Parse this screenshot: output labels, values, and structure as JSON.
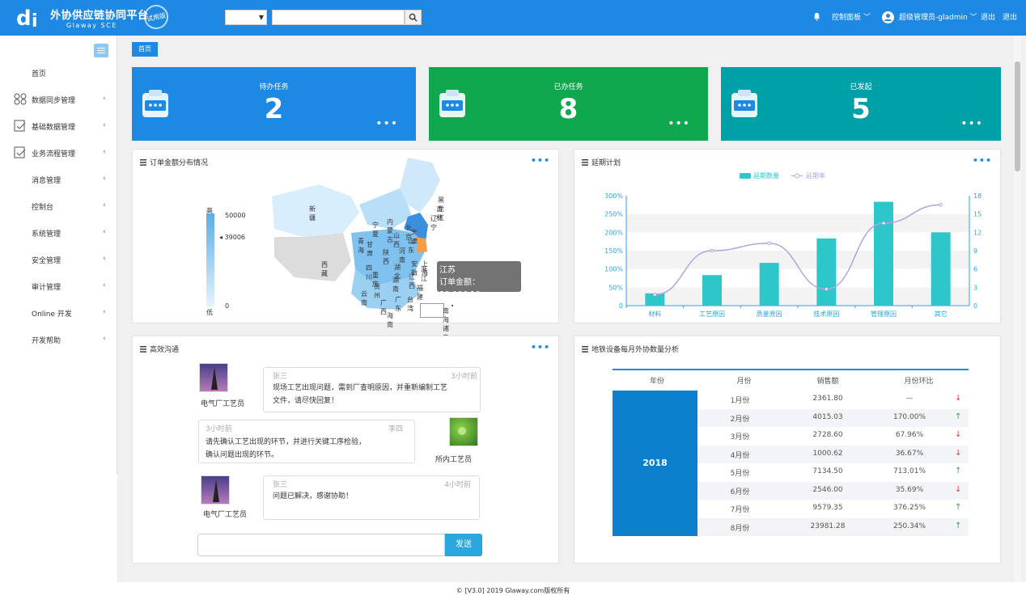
{
  "brand": {
    "title": "外协供应链协同平台",
    "subtitle": "Glaway SCE",
    "stamp": "试用版"
  },
  "topbar": {
    "dashboard": "控制面板 ﹀",
    "user": "超级管理员-gladmin ﹀",
    "logout1": "退出",
    "logout2": "退出"
  },
  "sidebar": {
    "items": [
      {
        "label": "首页",
        "chevron": ""
      },
      {
        "label": "数据同步管理",
        "chevron": "‹"
      },
      {
        "label": "基础数据管理",
        "chevron": "‹"
      },
      {
        "label": "业务流程管理",
        "chevron": "‹"
      },
      {
        "label": "消息管理",
        "chevron": "‹"
      },
      {
        "label": "控制台",
        "chevron": "‹"
      },
      {
        "label": "系统管理",
        "chevron": "‹"
      },
      {
        "label": "安全管理",
        "chevron": "‹"
      },
      {
        "label": "审计管理",
        "chevron": "‹"
      },
      {
        "label": "Online 开发",
        "chevron": "‹"
      },
      {
        "label": "开发帮助",
        "chevron": "‹"
      }
    ]
  },
  "breadcrumb": "首页",
  "stats": [
    {
      "title": "待办任务",
      "value": "2",
      "color": "#1e88e5"
    },
    {
      "title": "已办任务",
      "value": "8",
      "color": "#0fa84f"
    },
    {
      "title": "已发起",
      "value": "5",
      "color": "#00a0a8"
    }
  ],
  "more": "•••",
  "map_panel": {
    "title": "订单金额分布情况",
    "legend_high": "高",
    "legend_low": "低",
    "legend_values": [
      "50000",
      "39006",
      "0"
    ],
    "provinces": [
      "黑龙江",
      "吉林",
      "辽宁",
      "内蒙古",
      "新疆",
      "宁夏",
      "北京",
      "天津",
      "青海",
      "甘肃",
      "山西",
      "山东",
      "陕西",
      "河南",
      "江苏",
      "西藏",
      "四川",
      "湖北",
      "安徽",
      "浙江",
      "重庆",
      "上海",
      "江西",
      "湖南",
      "贵州",
      "福建",
      "云南",
      "广西",
      "广东",
      "台湾",
      "海南",
      "南海诸岛"
    ],
    "tooltip_name": "江苏",
    "tooltip_value": "订单金额：39,006.10"
  },
  "delay_panel": {
    "title": "延期计划",
    "legend_bar": "延期数量",
    "legend_line": "延期率"
  },
  "chart_data": {
    "type": "bar",
    "categories": [
      "材料",
      "工艺原因",
      "质量原因",
      "技术原因",
      "管理原因",
      "其它"
    ],
    "series": [
      {
        "name": "延期数量",
        "type": "bar",
        "axis": "right",
        "values": [
          2,
          5,
          7,
          11,
          17,
          12
        ]
      },
      {
        "name": "延期率",
        "type": "line",
        "axis": "left",
        "values": [
          30,
          150,
          170,
          45,
          225,
          275
        ]
      }
    ],
    "left_axis": {
      "ticks": [
        "0",
        "50%",
        "100%",
        "150%",
        "200%",
        "250%",
        "300%"
      ],
      "range": [
        0,
        300
      ]
    },
    "right_axis": {
      "ticks": [
        "0",
        "3",
        "6",
        "9",
        "12",
        "15",
        "18"
      ],
      "range": [
        0,
        18
      ]
    },
    "colors": {
      "bar": "#2ec7c9",
      "line": "#b6a2de"
    }
  },
  "chat_panel": {
    "title": "高效沟通",
    "messages": [
      {
        "name": "张三",
        "time": "3小时前",
        "role": "电气厂工艺员",
        "text1": "现场工艺出现问题，需到厂查明原因，并重新编制工艺",
        "text2": "文件，请尽快回复！"
      },
      {
        "name": "李四",
        "time": "3小时前",
        "role": "所内工艺员",
        "text1": "请先确认工艺出现的环节，并进行关键工序检验，",
        "text2": "确认问题出现的环节。"
      },
      {
        "name": "张三",
        "time": "4小时前",
        "role": "电气厂工艺员",
        "text1": "问题已解决，感谢协助！",
        "text2": ""
      }
    ],
    "send": "发送"
  },
  "table_panel": {
    "title": "地铁设备每月外协数量分析",
    "headers": [
      "年份",
      "月份",
      "销售额",
      "月份环比"
    ],
    "year": "2018",
    "rows": [
      {
        "month": "1月份",
        "sales": "2361.80",
        "ratio": "—",
        "dir": "down"
      },
      {
        "month": "2月份",
        "sales": "4015.03",
        "ratio": "170.00%",
        "dir": "up"
      },
      {
        "month": "3月份",
        "sales": "2728.60",
        "ratio": "67.96%",
        "dir": "down"
      },
      {
        "month": "4月份",
        "sales": "1000.62",
        "ratio": "36.67%",
        "dir": "down"
      },
      {
        "month": "5月份",
        "sales": "7134.50",
        "ratio": "713.01%",
        "dir": "up"
      },
      {
        "month": "6月份",
        "sales": "2546.00",
        "ratio": "35.69%",
        "dir": "down"
      },
      {
        "month": "7月份",
        "sales": "9579.35",
        "ratio": "376.25%",
        "dir": "up"
      },
      {
        "month": "8月份",
        "sales": "23981.28",
        "ratio": "250.34%",
        "dir": "up"
      }
    ]
  },
  "footer": "© [V3.0] 2019 Glaway.com版权所有"
}
